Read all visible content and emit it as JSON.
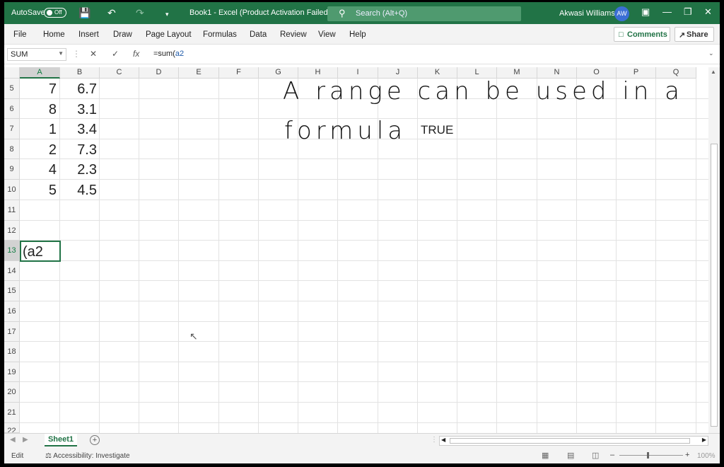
{
  "titlebar": {
    "autosave_label": "AutoSave",
    "autosave_state": "Off",
    "title": "Book1  -  Excel (Product Activation Failed)",
    "search_placeholder": "Search (Alt+Q)",
    "user_name": "Akwasi Williams",
    "user_initials": "AW"
  },
  "menu": {
    "items": [
      "File",
      "Home",
      "Insert",
      "Draw",
      "Page Layout",
      "Formulas",
      "Data",
      "Review",
      "View",
      "Help"
    ],
    "comments": "Comments",
    "share": "Share"
  },
  "formula_bar": {
    "name_box": "SUM",
    "fx": "fx",
    "formula_prefix": "=sum(",
    "formula_ref": "a2"
  },
  "grid": {
    "columns": [
      "A",
      "B",
      "C",
      "D",
      "E",
      "F",
      "G",
      "H",
      "I",
      "J",
      "K",
      "L",
      "M",
      "N",
      "O",
      "P",
      "Q"
    ],
    "selected_column": "A",
    "rows": [
      "5",
      "6",
      "7",
      "8",
      "9",
      "10",
      "11",
      "12",
      "13",
      "14",
      "15",
      "16",
      "17",
      "18",
      "19",
      "20",
      "21",
      "22"
    ],
    "col_a_values": [
      "7",
      "8",
      "1",
      "2",
      "4",
      "5"
    ],
    "col_b_values": [
      "6.7",
      "3.1",
      "3.4",
      "7.3",
      "2.3",
      "4.5"
    ],
    "active_cell_text": "(a2",
    "handwriting_line1": "A range can be used in a",
    "handwriting_line2": "formula",
    "true_text": "TRUE"
  },
  "sheets": {
    "tab": "Sheet1"
  },
  "status": {
    "mode": "Edit",
    "accessibility": "Accessibility: Investigate",
    "zoom": "100%"
  },
  "colors": {
    "excel_green": "#217346",
    "avatar_blue": "#3b6fd4"
  }
}
